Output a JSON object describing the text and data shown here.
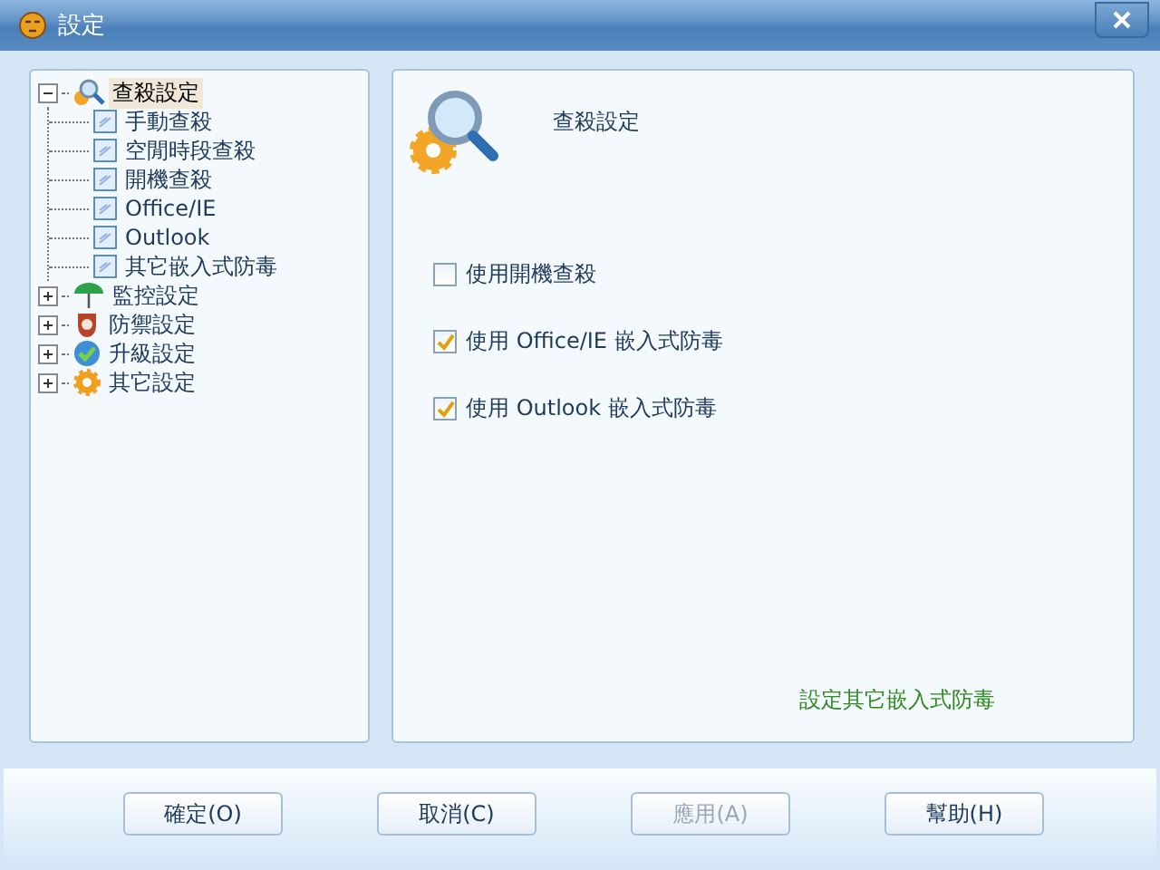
{
  "window": {
    "title": "設定"
  },
  "tree": [
    {
      "label": "查殺設定",
      "kind": "scan",
      "expanded": true,
      "selected": true,
      "children": [
        {
          "label": "手動查殺",
          "kind": "page",
          "selected": false
        },
        {
          "label": "空閒時段查殺",
          "kind": "page",
          "selected": false
        },
        {
          "label": "開機查殺",
          "kind": "page",
          "selected": false
        },
        {
          "label": "Office/IE",
          "kind": "page",
          "selected": false
        },
        {
          "label": "Outlook",
          "kind": "page",
          "selected": false
        },
        {
          "label": "其它嵌入式防毒",
          "kind": "page",
          "selected": false
        }
      ]
    },
    {
      "label": "監控設定",
      "kind": "umbrella",
      "expanded": false,
      "selected": false
    },
    {
      "label": "防禦設定",
      "kind": "shield",
      "expanded": false,
      "selected": false
    },
    {
      "label": "升級設定",
      "kind": "globe",
      "expanded": false,
      "selected": false
    },
    {
      "label": "其它設定",
      "kind": "gear",
      "expanded": false,
      "selected": false
    }
  ],
  "panel": {
    "heading": "查殺設定",
    "options": [
      {
        "label": "使用開機查殺",
        "checked": false
      },
      {
        "label": "使用 Office/IE 嵌入式防毒",
        "checked": true
      },
      {
        "label": "使用 Outlook 嵌入式防毒",
        "checked": true
      }
    ],
    "link": "設定其它嵌入式防毒"
  },
  "buttons": [
    {
      "label": "確定(O)",
      "disabled": false
    },
    {
      "label": "取消(C)",
      "disabled": false
    },
    {
      "label": "應用(A)",
      "disabled": true
    },
    {
      "label": "幫助(H)",
      "disabled": false
    }
  ]
}
